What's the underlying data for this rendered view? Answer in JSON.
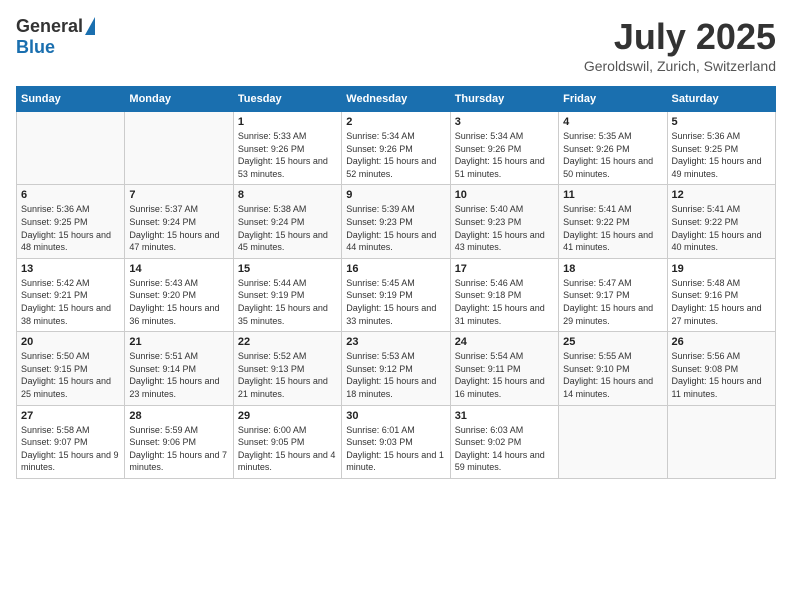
{
  "header": {
    "logo_general": "General",
    "logo_blue": "Blue",
    "month_year": "July 2025",
    "location": "Geroldswil, Zurich, Switzerland"
  },
  "weekdays": [
    "Sunday",
    "Monday",
    "Tuesday",
    "Wednesday",
    "Thursday",
    "Friday",
    "Saturday"
  ],
  "weeks": [
    [
      {
        "day": "",
        "sunrise": "",
        "sunset": "",
        "daylight": ""
      },
      {
        "day": "",
        "sunrise": "",
        "sunset": "",
        "daylight": ""
      },
      {
        "day": "1",
        "sunrise": "Sunrise: 5:33 AM",
        "sunset": "Sunset: 9:26 PM",
        "daylight": "Daylight: 15 hours and 53 minutes."
      },
      {
        "day": "2",
        "sunrise": "Sunrise: 5:34 AM",
        "sunset": "Sunset: 9:26 PM",
        "daylight": "Daylight: 15 hours and 52 minutes."
      },
      {
        "day": "3",
        "sunrise": "Sunrise: 5:34 AM",
        "sunset": "Sunset: 9:26 PM",
        "daylight": "Daylight: 15 hours and 51 minutes."
      },
      {
        "day": "4",
        "sunrise": "Sunrise: 5:35 AM",
        "sunset": "Sunset: 9:26 PM",
        "daylight": "Daylight: 15 hours and 50 minutes."
      },
      {
        "day": "5",
        "sunrise": "Sunrise: 5:36 AM",
        "sunset": "Sunset: 9:25 PM",
        "daylight": "Daylight: 15 hours and 49 minutes."
      }
    ],
    [
      {
        "day": "6",
        "sunrise": "Sunrise: 5:36 AM",
        "sunset": "Sunset: 9:25 PM",
        "daylight": "Daylight: 15 hours and 48 minutes."
      },
      {
        "day": "7",
        "sunrise": "Sunrise: 5:37 AM",
        "sunset": "Sunset: 9:24 PM",
        "daylight": "Daylight: 15 hours and 47 minutes."
      },
      {
        "day": "8",
        "sunrise": "Sunrise: 5:38 AM",
        "sunset": "Sunset: 9:24 PM",
        "daylight": "Daylight: 15 hours and 45 minutes."
      },
      {
        "day": "9",
        "sunrise": "Sunrise: 5:39 AM",
        "sunset": "Sunset: 9:23 PM",
        "daylight": "Daylight: 15 hours and 44 minutes."
      },
      {
        "day": "10",
        "sunrise": "Sunrise: 5:40 AM",
        "sunset": "Sunset: 9:23 PM",
        "daylight": "Daylight: 15 hours and 43 minutes."
      },
      {
        "day": "11",
        "sunrise": "Sunrise: 5:41 AM",
        "sunset": "Sunset: 9:22 PM",
        "daylight": "Daylight: 15 hours and 41 minutes."
      },
      {
        "day": "12",
        "sunrise": "Sunrise: 5:41 AM",
        "sunset": "Sunset: 9:22 PM",
        "daylight": "Daylight: 15 hours and 40 minutes."
      }
    ],
    [
      {
        "day": "13",
        "sunrise": "Sunrise: 5:42 AM",
        "sunset": "Sunset: 9:21 PM",
        "daylight": "Daylight: 15 hours and 38 minutes."
      },
      {
        "day": "14",
        "sunrise": "Sunrise: 5:43 AM",
        "sunset": "Sunset: 9:20 PM",
        "daylight": "Daylight: 15 hours and 36 minutes."
      },
      {
        "day": "15",
        "sunrise": "Sunrise: 5:44 AM",
        "sunset": "Sunset: 9:19 PM",
        "daylight": "Daylight: 15 hours and 35 minutes."
      },
      {
        "day": "16",
        "sunrise": "Sunrise: 5:45 AM",
        "sunset": "Sunset: 9:19 PM",
        "daylight": "Daylight: 15 hours and 33 minutes."
      },
      {
        "day": "17",
        "sunrise": "Sunrise: 5:46 AM",
        "sunset": "Sunset: 9:18 PM",
        "daylight": "Daylight: 15 hours and 31 minutes."
      },
      {
        "day": "18",
        "sunrise": "Sunrise: 5:47 AM",
        "sunset": "Sunset: 9:17 PM",
        "daylight": "Daylight: 15 hours and 29 minutes."
      },
      {
        "day": "19",
        "sunrise": "Sunrise: 5:48 AM",
        "sunset": "Sunset: 9:16 PM",
        "daylight": "Daylight: 15 hours and 27 minutes."
      }
    ],
    [
      {
        "day": "20",
        "sunrise": "Sunrise: 5:50 AM",
        "sunset": "Sunset: 9:15 PM",
        "daylight": "Daylight: 15 hours and 25 minutes."
      },
      {
        "day": "21",
        "sunrise": "Sunrise: 5:51 AM",
        "sunset": "Sunset: 9:14 PM",
        "daylight": "Daylight: 15 hours and 23 minutes."
      },
      {
        "day": "22",
        "sunrise": "Sunrise: 5:52 AM",
        "sunset": "Sunset: 9:13 PM",
        "daylight": "Daylight: 15 hours and 21 minutes."
      },
      {
        "day": "23",
        "sunrise": "Sunrise: 5:53 AM",
        "sunset": "Sunset: 9:12 PM",
        "daylight": "Daylight: 15 hours and 18 minutes."
      },
      {
        "day": "24",
        "sunrise": "Sunrise: 5:54 AM",
        "sunset": "Sunset: 9:11 PM",
        "daylight": "Daylight: 15 hours and 16 minutes."
      },
      {
        "day": "25",
        "sunrise": "Sunrise: 5:55 AM",
        "sunset": "Sunset: 9:10 PM",
        "daylight": "Daylight: 15 hours and 14 minutes."
      },
      {
        "day": "26",
        "sunrise": "Sunrise: 5:56 AM",
        "sunset": "Sunset: 9:08 PM",
        "daylight": "Daylight: 15 hours and 11 minutes."
      }
    ],
    [
      {
        "day": "27",
        "sunrise": "Sunrise: 5:58 AM",
        "sunset": "Sunset: 9:07 PM",
        "daylight": "Daylight: 15 hours and 9 minutes."
      },
      {
        "day": "28",
        "sunrise": "Sunrise: 5:59 AM",
        "sunset": "Sunset: 9:06 PM",
        "daylight": "Daylight: 15 hours and 7 minutes."
      },
      {
        "day": "29",
        "sunrise": "Sunrise: 6:00 AM",
        "sunset": "Sunset: 9:05 PM",
        "daylight": "Daylight: 15 hours and 4 minutes."
      },
      {
        "day": "30",
        "sunrise": "Sunrise: 6:01 AM",
        "sunset": "Sunset: 9:03 PM",
        "daylight": "Daylight: 15 hours and 1 minute."
      },
      {
        "day": "31",
        "sunrise": "Sunrise: 6:03 AM",
        "sunset": "Sunset: 9:02 PM",
        "daylight": "Daylight: 14 hours and 59 minutes."
      },
      {
        "day": "",
        "sunrise": "",
        "sunset": "",
        "daylight": ""
      },
      {
        "day": "",
        "sunrise": "",
        "sunset": "",
        "daylight": ""
      }
    ]
  ]
}
